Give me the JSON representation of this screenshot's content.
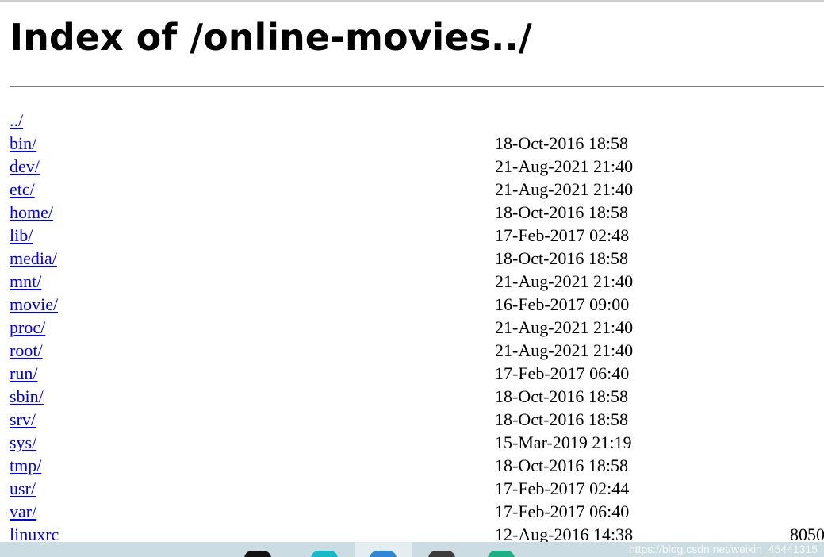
{
  "page": {
    "title": "Index of /online-movies../"
  },
  "entries": [
    {
      "name": "../",
      "date": "",
      "size": ""
    },
    {
      "name": "bin/",
      "date": "18-Oct-2016 18:58",
      "size": ""
    },
    {
      "name": "dev/",
      "date": "21-Aug-2021 21:40",
      "size": ""
    },
    {
      "name": "etc/",
      "date": "21-Aug-2021 21:40",
      "size": ""
    },
    {
      "name": "home/",
      "date": "18-Oct-2016 18:58",
      "size": ""
    },
    {
      "name": "lib/",
      "date": "17-Feb-2017 02:48",
      "size": ""
    },
    {
      "name": "media/",
      "date": "18-Oct-2016 18:58",
      "size": ""
    },
    {
      "name": "mnt/",
      "date": "21-Aug-2021 21:40",
      "size": ""
    },
    {
      "name": "movie/",
      "date": "16-Feb-2017 09:00",
      "size": ""
    },
    {
      "name": "proc/",
      "date": "21-Aug-2021 21:40",
      "size": ""
    },
    {
      "name": "root/",
      "date": "21-Aug-2021 21:40",
      "size": ""
    },
    {
      "name": "run/",
      "date": "17-Feb-2017 06:40",
      "size": ""
    },
    {
      "name": "sbin/",
      "date": "18-Oct-2016 18:58",
      "size": ""
    },
    {
      "name": "srv/",
      "date": "18-Oct-2016 18:58",
      "size": ""
    },
    {
      "name": "sys/",
      "date": "15-Mar-2019 21:19",
      "size": ""
    },
    {
      "name": "tmp/",
      "date": "18-Oct-2016 18:58",
      "size": ""
    },
    {
      "name": "usr/",
      "date": "17-Feb-2017 02:44",
      "size": ""
    },
    {
      "name": "var/",
      "date": "17-Feb-2017 06:40",
      "size": ""
    },
    {
      "name": "linuxrc",
      "date": "12-Aug-2016 14:38",
      "size": "8050"
    }
  ],
  "taskbar": {
    "watermark": "https://blog.csdn.net/weixin_45441315"
  },
  "colors": {
    "link": "#0000ee",
    "text": "#000000",
    "taskbar": "#cbdde2"
  }
}
